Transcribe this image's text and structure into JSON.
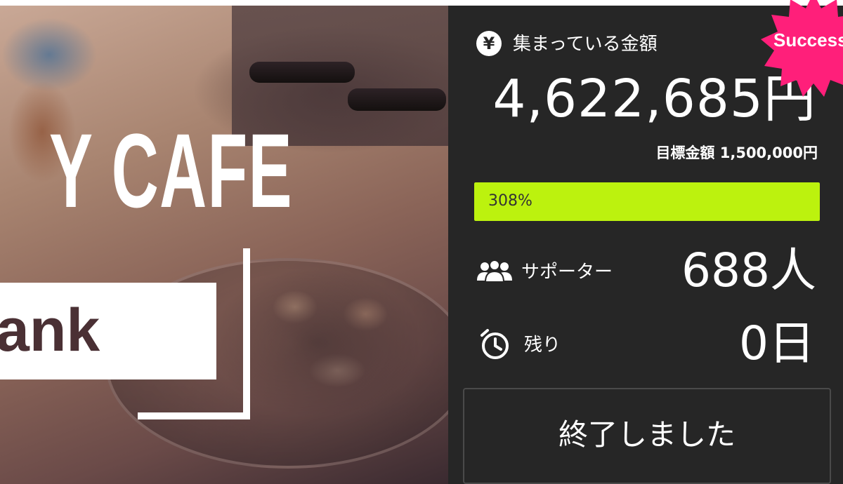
{
  "hero": {
    "title": "Y CAFE",
    "logo_text": "ank"
  },
  "stats": {
    "raised_label": "集まっている金額",
    "raised_amount": "4,622,685円",
    "goal_text": "目標金額 1,500,000円",
    "progress_text": "308%",
    "progress_fraction": 1.0,
    "supporters_label": "サポーター",
    "supporters_value": "688人",
    "remaining_label": "残り",
    "remaining_value": "0日",
    "finish_button_label": "終了しました",
    "badge_text": "Success"
  },
  "icons": {
    "raised": "yen-icon",
    "supporters": "people-icon",
    "remaining": "timer-icon"
  },
  "colors": {
    "panel_bg": "#262626",
    "progress_fill": "#bcf20e",
    "badge": "#ff1f7a"
  }
}
